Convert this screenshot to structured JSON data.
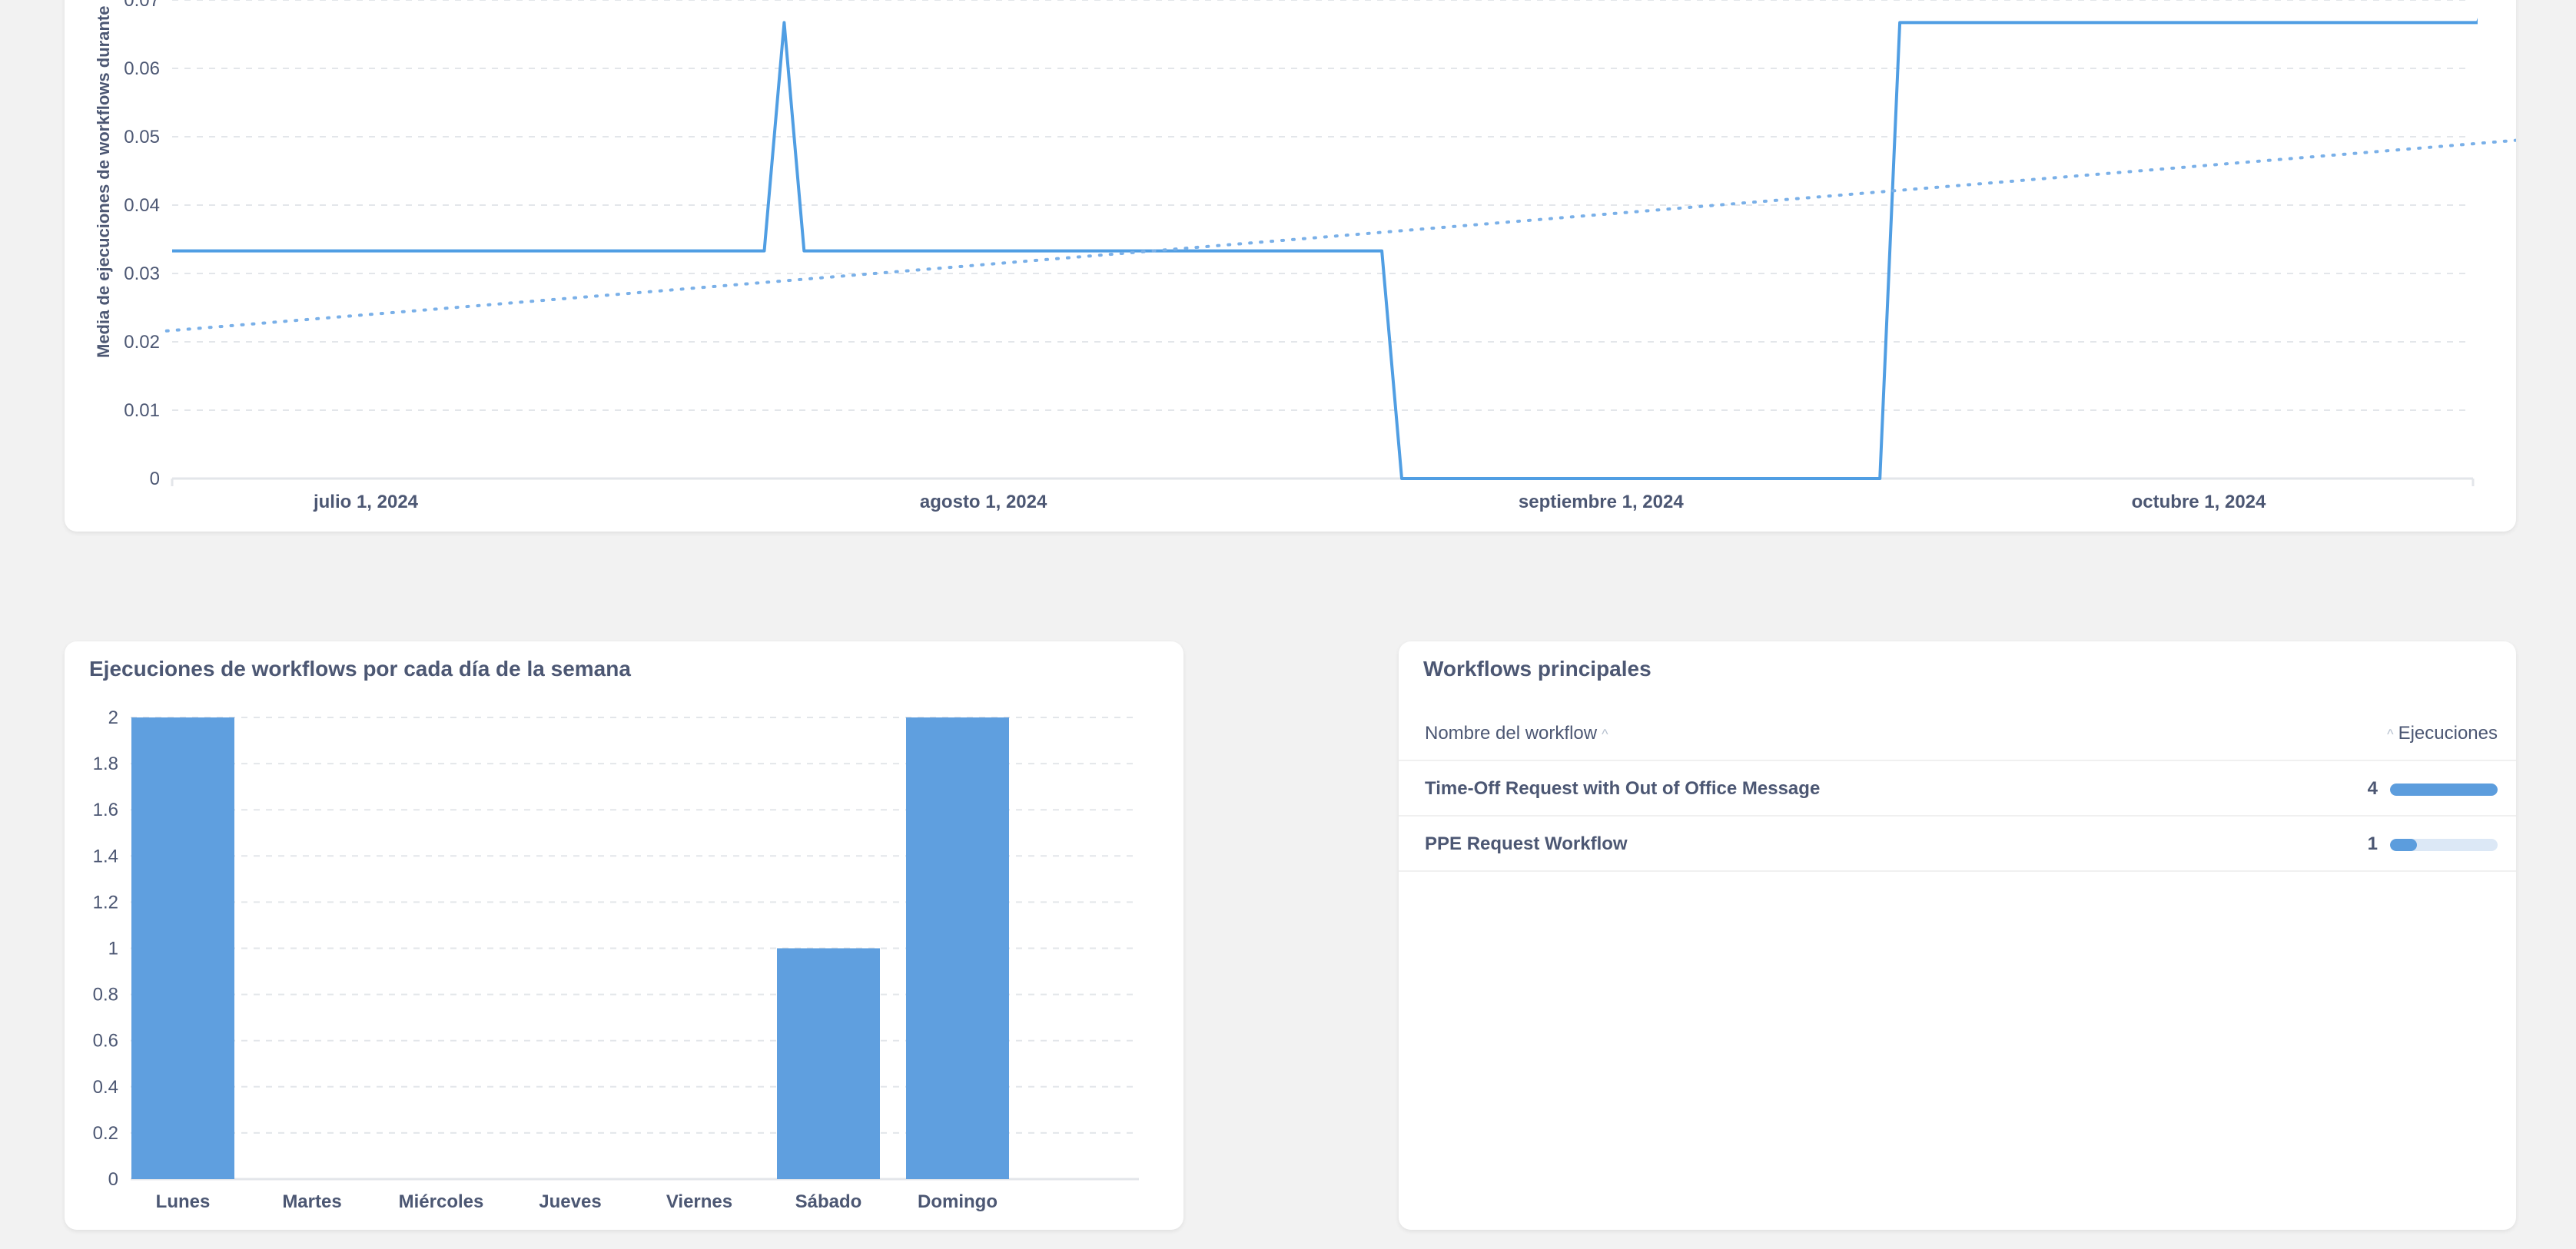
{
  "line_card": {
    "ylabel": "Media de ejecuciones de workflows durante los úl"
  },
  "bar_card": {
    "title": "Ejecuciones de workflows por cada día de la semana"
  },
  "table_card": {
    "title": "Workflows principales",
    "col_name": "Nombre del workflow",
    "col_value": "Ejecuciones",
    "rows": [
      {
        "name": "Time-Off Request with Out of Office Message",
        "count": "4",
        "fraction": 1.0
      },
      {
        "name": "PPE Request Workflow",
        "count": "1",
        "fraction": 0.25
      }
    ]
  },
  "colors": {
    "series": "#509ee3",
    "bar": "#5f9fdf",
    "grid": "#e3e6ea",
    "bar_track": "#dce8f6"
  },
  "chart_data": [
    {
      "type": "line",
      "ylabel": "Media de ejecuciones de workflows durante los úl",
      "y_ticks": [
        "0",
        "0.01",
        "0.02",
        "0.03",
        "0.04",
        "0.05",
        "0.06",
        "0.07"
      ],
      "x_ticks": [
        "julio 1, 2024",
        "agosto 1, 2024",
        "septiembre 1, 2024",
        "octubre 1, 2024"
      ],
      "ylim": [
        0,
        0.07
      ],
      "grid": true,
      "series": [
        {
          "points": [
            [
              "2024-06-21",
              0.0333
            ],
            [
              "2024-07-21",
              0.0333
            ],
            [
              "2024-07-22",
              0.0667
            ],
            [
              "2024-07-23",
              0.0333
            ],
            [
              "2024-08-21",
              0.0333
            ],
            [
              "2024-08-22",
              0.0
            ],
            [
              "2024-09-15",
              0.0
            ],
            [
              "2024-09-16",
              0.0667
            ],
            [
              "2024-10-15",
              0.0667
            ],
            [
              "2024-10-16",
              0.075
            ]
          ]
        },
        {
          "style": "dotted",
          "points": [
            [
              "2024-06-21",
              0.0216
            ],
            [
              "2024-10-17",
              0.0495
            ]
          ]
        }
      ]
    },
    {
      "type": "bar",
      "title": "Ejecuciones de workflows por cada día de la semana",
      "categories": [
        "Lunes",
        "Martes",
        "Miércoles",
        "Jueves",
        "Viernes",
        "Sábado",
        "Domingo"
      ],
      "values": [
        2,
        0,
        0,
        0,
        0,
        1,
        2
      ],
      "y_ticks": [
        "0",
        "0.2",
        "0.4",
        "0.6",
        "0.8",
        "1",
        "1.2",
        "1.4",
        "1.6",
        "1.8",
        "2"
      ],
      "ylim": [
        0,
        2
      ],
      "grid": true
    }
  ]
}
